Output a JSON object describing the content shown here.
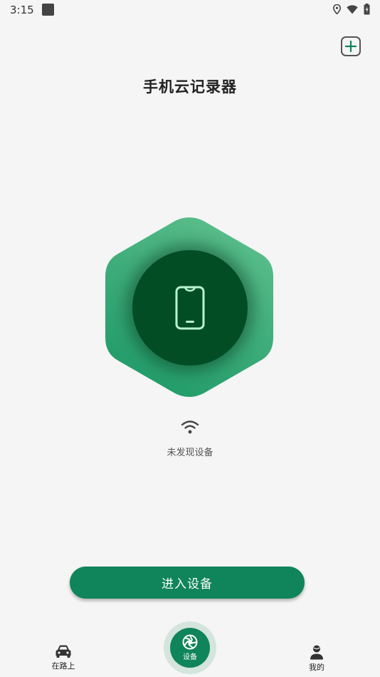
{
  "status_bar": {
    "time": "3:15"
  },
  "header": {
    "title": "手机云记录器"
  },
  "device": {
    "status_text": "未发现设备"
  },
  "actions": {
    "enter_label": "进入设备"
  },
  "bottom_nav": {
    "items": [
      {
        "label": "在路上",
        "icon": "car-icon"
      },
      {
        "label": "设备",
        "icon": "aperture-icon"
      },
      {
        "label": "我的",
        "icon": "person-icon"
      }
    ]
  },
  "colors": {
    "accent": "#10845a",
    "hex_light": "#5cbf8c",
    "hex_dark": "#1f9a68",
    "core": "#034d25",
    "phone_outline": "#b8f3cf"
  }
}
